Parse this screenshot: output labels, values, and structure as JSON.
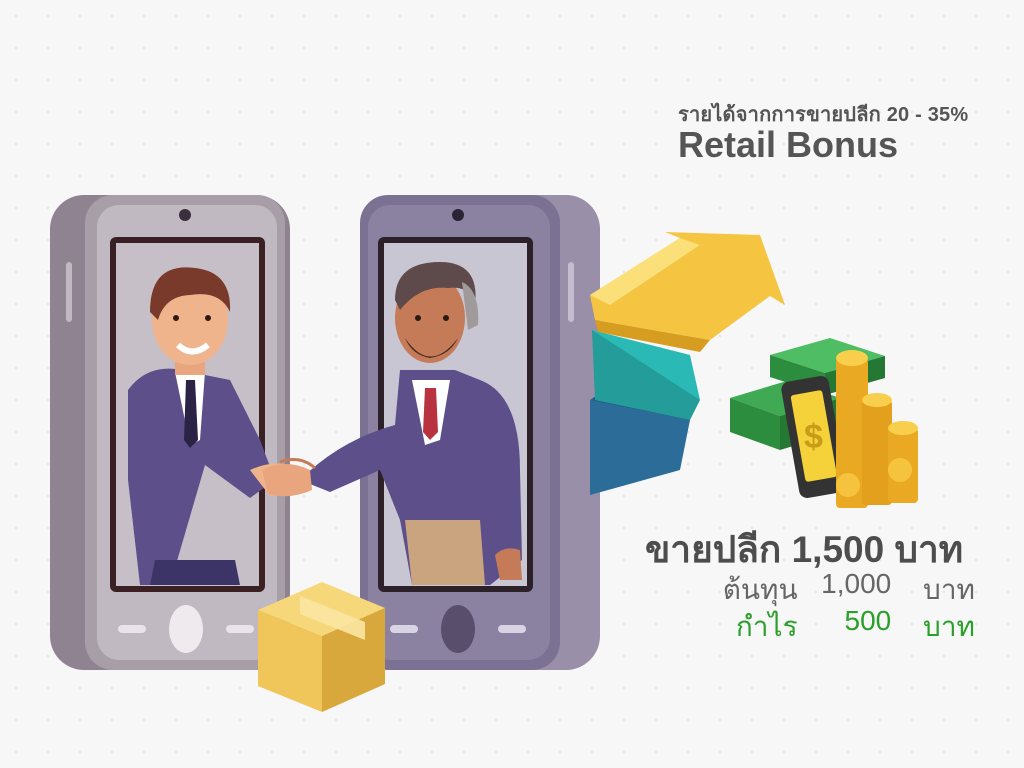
{
  "header": {
    "subtitle": "รายได้จากการขายปลีก 20 - 35%",
    "title": "Retail Bonus"
  },
  "pricing": {
    "retail_line": "ขายปลีก 1,500 บาท",
    "cost": {
      "label": "ต้นทุน",
      "value": "1,000",
      "unit": "บาท"
    },
    "profit": {
      "label": "กำไร",
      "value": "500",
      "unit": "บาท"
    }
  },
  "colors": {
    "text_dark": "#4d4d4d",
    "profit_green": "#2aa02a",
    "phone_left": "#a79ea7",
    "phone_right": "#7b7193",
    "suit": "#5d4f8a",
    "box": "#f0c55a",
    "arrow_yellow": "#f5c542",
    "arrow_teal": "#2bb9b6",
    "arrow_blue": "#2b6c99"
  },
  "icons": [
    "phone-icon",
    "handshake-icon",
    "package-box-icon",
    "up-arrow-icon",
    "money-stack-icon",
    "coin-stack-icon",
    "dollar-phone-icon"
  ]
}
